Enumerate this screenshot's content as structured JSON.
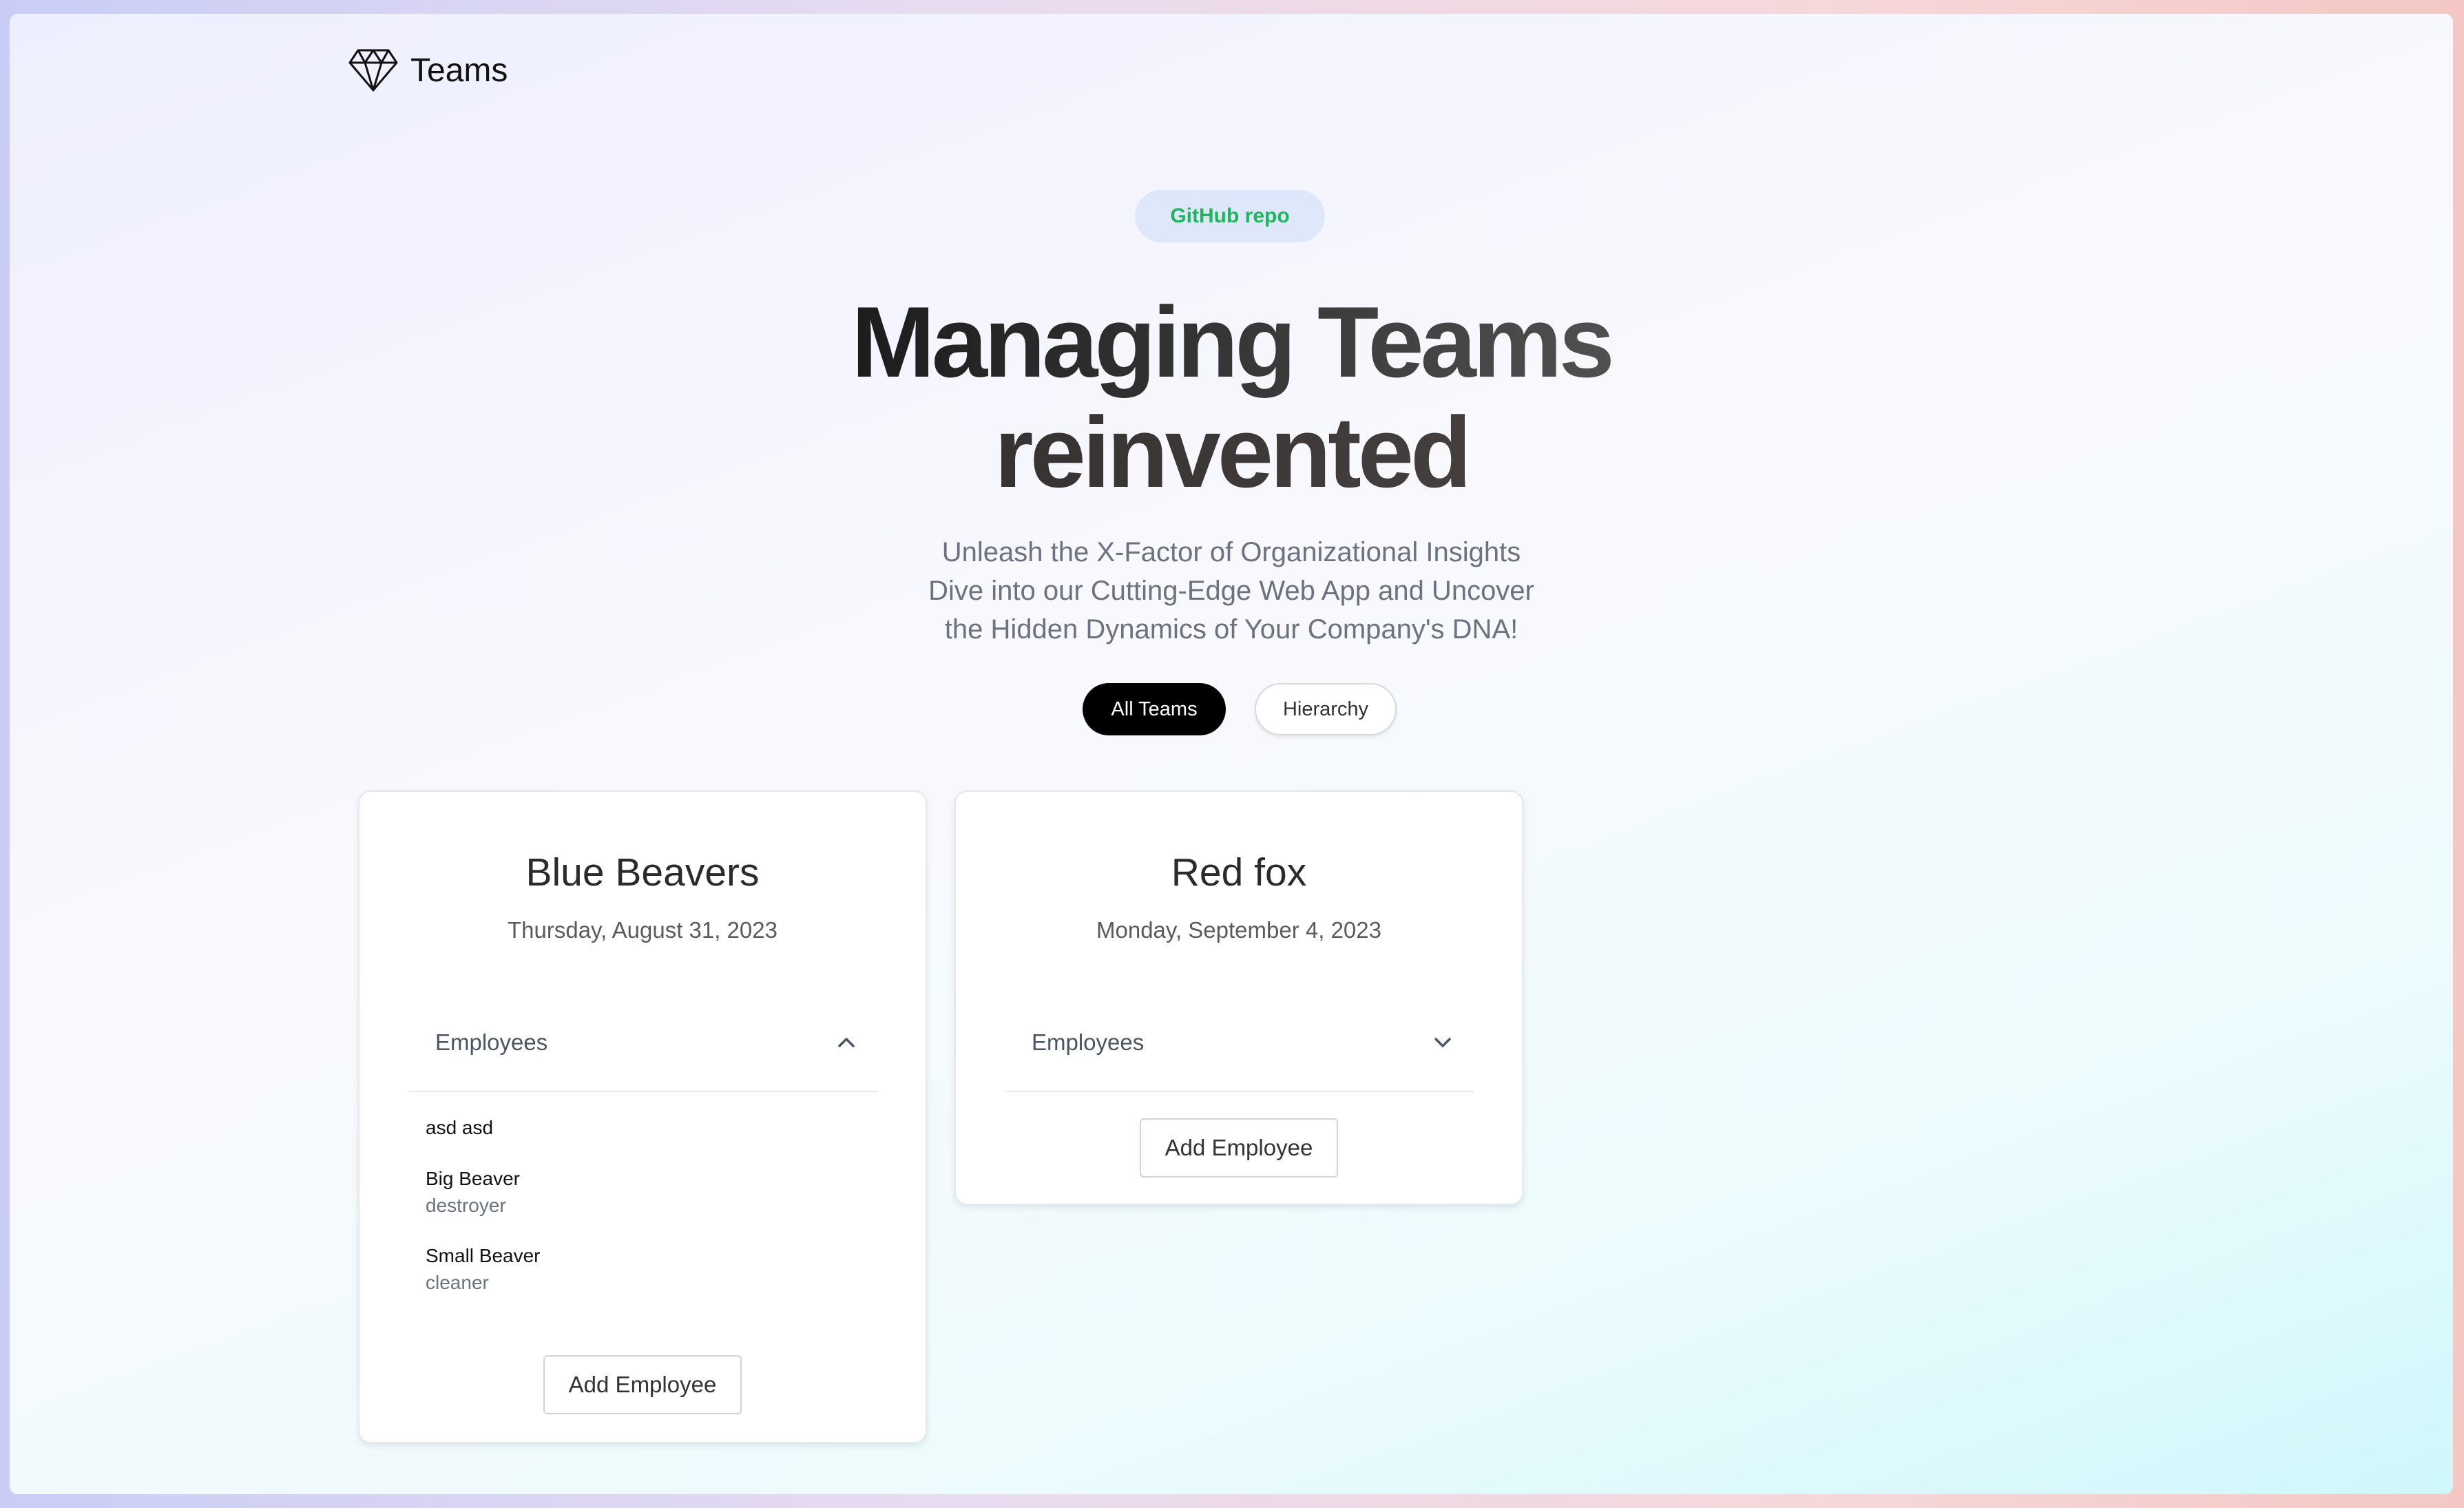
{
  "brand": {
    "name": "Teams",
    "icon": "diamond-icon"
  },
  "hero": {
    "badge": "GitHub repo",
    "title_line1": "Managing Teams",
    "title_line2": "reinvented",
    "subtitle_lines": [
      "Unleash the X-Factor of Organizational Insights",
      "Dive into our Cutting-Edge Web App and Uncover",
      "the Hidden Dynamics of Your Company's DNA!"
    ]
  },
  "tabs": [
    {
      "label": "All Teams",
      "active": true
    },
    {
      "label": "Hierarchy",
      "active": false
    }
  ],
  "teams": [
    {
      "name": "Blue Beavers",
      "date": "Thursday, August 31, 2023",
      "section_label": "Employees",
      "expanded": true,
      "employees": [
        {
          "name": "asd asd",
          "role": ""
        },
        {
          "name": "Big Beaver",
          "role": "destroyer"
        },
        {
          "name": "Small Beaver",
          "role": "cleaner"
        }
      ],
      "add_label": "Add Employee"
    },
    {
      "name": "Red fox",
      "date": "Monday, September 4, 2023",
      "section_label": "Employees",
      "expanded": false,
      "employees": [],
      "add_label": "Add Employee"
    }
  ],
  "colors": {
    "badge_text": "#20b55d",
    "badge_bg": "#dfe8fb",
    "active_tab_bg": "#000000"
  }
}
